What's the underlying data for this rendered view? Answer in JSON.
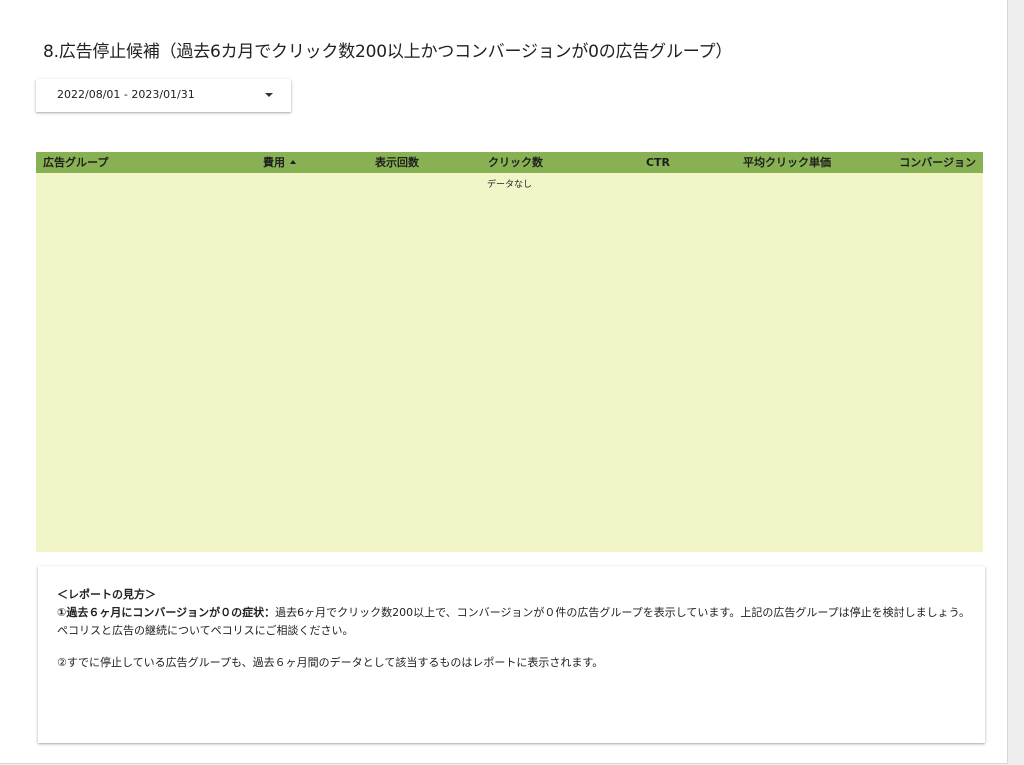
{
  "header": {
    "title": "8.広告停止候補（過去6カ月でクリック数200以上かつコンバージョンが0の広告グループ）"
  },
  "date_range": {
    "value": "2022/08/01 - 2023/01/31"
  },
  "table": {
    "columns": [
      {
        "key": "ad_group",
        "label": "広告グループ",
        "sorted": false
      },
      {
        "key": "cost",
        "label": "費用",
        "sorted": true,
        "sort_direction": "ascending"
      },
      {
        "key": "impressions",
        "label": "表示回数",
        "sorted": false
      },
      {
        "key": "clicks",
        "label": "クリック数",
        "sorted": false
      },
      {
        "key": "ctr",
        "label": "CTR",
        "sorted": false
      },
      {
        "key": "avg_cpc",
        "label": "平均クリック単価",
        "sorted": false
      },
      {
        "key": "conversions",
        "label": "コンバージョン",
        "sorted": false
      }
    ],
    "rows": [],
    "empty_message": "データなし"
  },
  "notes": {
    "heading": "＜レポートの見方＞",
    "item1_label": "①過去６ヶ月にコンバージョンが０の症状：",
    "item1_text": "過去6ヶ月でクリック数200以上で、コンバージョンが０件の広告グループを表示しています。上記の広告グループは停止を検討しましょう。ペコリスと広告の継続についてペコリスにご相談ください。",
    "item2_text": "②すでに停止している広告グループも、過去６ヶ月間のデータとして該当するものはレポートに表示されます。"
  },
  "colors": {
    "header_green": "#87b152",
    "table_body": "#f1f5c7"
  }
}
